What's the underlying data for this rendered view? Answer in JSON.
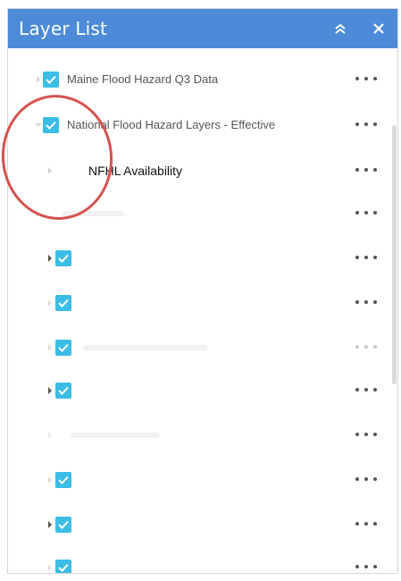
{
  "header": {
    "title": "Layer List",
    "collapse_icon": "double-chevron-up-icon",
    "close_icon": "close-icon",
    "color": "#4d8bd8"
  },
  "layers": [
    {
      "label": "Maine Flood Hazard Q3 Data",
      "checked": true,
      "caret": "right"
    },
    {
      "label": "National Flood Hazard Layers - Effective",
      "checked": true,
      "caret": "down"
    },
    {
      "label": "NFHL Availability",
      "checked": false,
      "caret": "right"
    },
    {
      "label": "",
      "checked": false,
      "caret": "right"
    },
    {
      "label": "",
      "checked": true,
      "caret": "right"
    },
    {
      "label": "",
      "checked": true,
      "caret": "right"
    },
    {
      "label": "",
      "checked": true,
      "caret": "right"
    },
    {
      "label": "",
      "checked": true,
      "caret": "right"
    },
    {
      "label": "",
      "checked": false,
      "caret": "right"
    },
    {
      "label": "",
      "checked": true,
      "caret": "right"
    },
    {
      "label": "",
      "checked": true,
      "caret": "right"
    },
    {
      "label": "",
      "checked": true,
      "caret": "right"
    }
  ],
  "more_icon": "more-options-icon",
  "checkbox_color": "#3bbde5"
}
